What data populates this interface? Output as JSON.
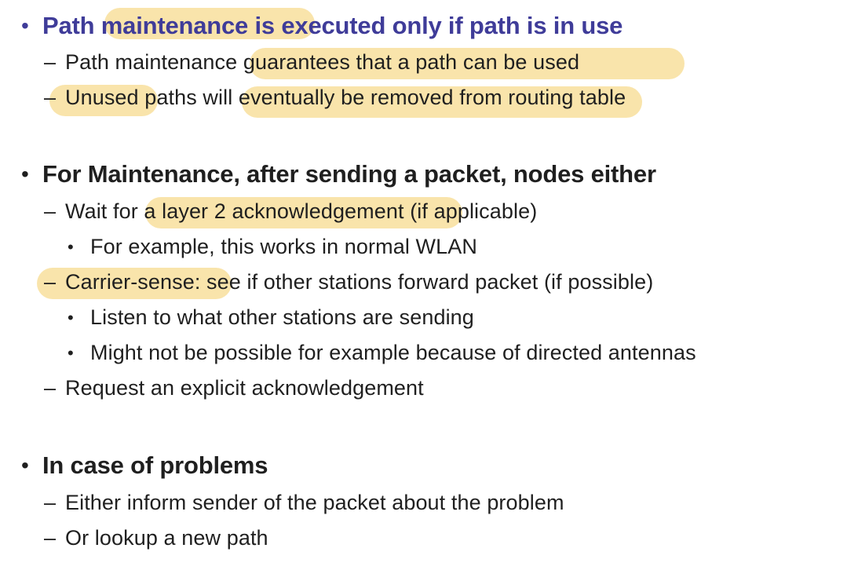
{
  "colors": {
    "heading_blue": "#3f3c99",
    "text": "#1f1f1f",
    "highlight": "#f6d98a"
  },
  "sections": [
    {
      "heading": "Path maintenance is executed only if path is in use",
      "items": [
        {
          "text": "Path maintenance guarantees that a path can be used"
        },
        {
          "text": "Unused paths will eventually be removed from routing table"
        }
      ]
    },
    {
      "heading": "For Maintenance, after sending a packet, nodes either",
      "items": [
        {
          "text": "Wait for a layer 2 acknowledgement (if applicable)",
          "subitems": [
            "For example, this works in normal WLAN"
          ]
        },
        {
          "text": "Carrier-sense: see if other stations forward packet (if possible)",
          "subitems": [
            "Listen to what other stations are sending",
            "Might not be possible for example because of directed antennas"
          ]
        },
        {
          "text": "Request an explicit acknowledgement"
        }
      ]
    },
    {
      "heading": "In case of problems",
      "items": [
        {
          "text": "Either inform sender of the packet about the problem"
        },
        {
          "text": "Or lookup a new path"
        }
      ]
    }
  ],
  "markers": {
    "level1": "•",
    "level2": "–",
    "level3": "•"
  }
}
